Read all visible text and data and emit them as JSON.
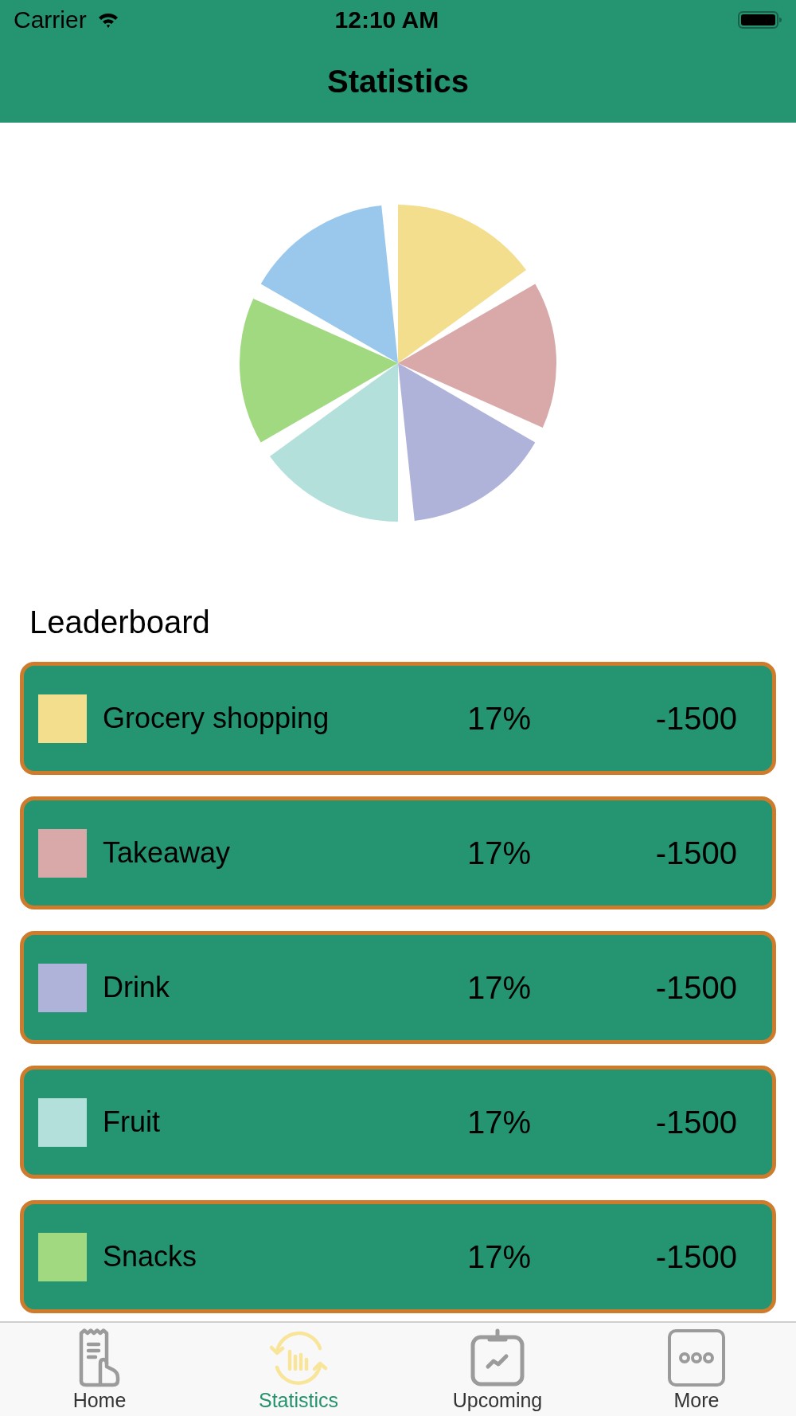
{
  "status_bar": {
    "carrier": "Carrier",
    "time": "12:10 AM"
  },
  "header": {
    "title": "Statistics"
  },
  "pie": {
    "slices": [
      {
        "color": "#f3de8e"
      },
      {
        "color": "#d9a9a9"
      },
      {
        "color": "#b0b3d9"
      },
      {
        "color": "#b3e0da"
      },
      {
        "color": "#a1d981"
      },
      {
        "color": "#99c8ec"
      }
    ]
  },
  "leaderboard": {
    "title": "Leaderboard",
    "rows": [
      {
        "name": "Grocery shopping",
        "color": "#f3de8e",
        "percent": "17%",
        "amount": "-1500"
      },
      {
        "name": "Takeaway",
        "color": "#d9a9a9",
        "percent": "17%",
        "amount": "-1500"
      },
      {
        "name": "Drink",
        "color": "#b0b3d9",
        "percent": "17%",
        "amount": "-1500"
      },
      {
        "name": "Fruit",
        "color": "#b3e0da",
        "percent": "17%",
        "amount": "-1500"
      },
      {
        "name": "Snacks",
        "color": "#a1d981",
        "percent": "17%",
        "amount": "-1500"
      }
    ]
  },
  "tab_bar": {
    "tabs": [
      {
        "label": "Home",
        "selected": false
      },
      {
        "label": "Statistics",
        "selected": true
      },
      {
        "label": "Upcoming",
        "selected": false
      },
      {
        "label": "More",
        "selected": false
      }
    ]
  }
}
